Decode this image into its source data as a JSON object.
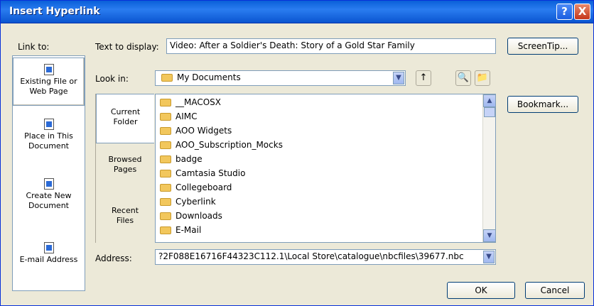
{
  "window": {
    "title": "Insert Hyperlink",
    "help_glyph": "?",
    "close_glyph": "X"
  },
  "labels": {
    "link_to": "Link to:",
    "text_to_display": "Text to display:",
    "look_in": "Look in:",
    "address": "Address:"
  },
  "link_to_items": [
    {
      "line1": "Existing File or",
      "line2": "Web Page",
      "icon": "existing-file-icon",
      "selected": true
    },
    {
      "line1": "Place in This",
      "line2": "Document",
      "icon": "place-in-document-icon",
      "selected": false
    },
    {
      "line1": "Create New",
      "line2": "Document",
      "icon": "create-new-document-icon",
      "selected": false
    },
    {
      "line1": "E-mail Address",
      "line2": "",
      "icon": "email-address-icon",
      "selected": false
    }
  ],
  "text_to_display_value": "Video: After a Soldier's Death: Story of a Gold Star Family",
  "look_in_value": "My Documents",
  "tabs": [
    {
      "line1": "Current",
      "line2": "Folder",
      "selected": true
    },
    {
      "line1": "Browsed",
      "line2": "Pages",
      "selected": false
    },
    {
      "line1": "Recent",
      "line2": "Files",
      "selected": false
    }
  ],
  "files": [
    "__MACOSX",
    "AIMC",
    "AOO Widgets",
    "AOO_Subscription_Mocks",
    "badge",
    "Camtasia Studio",
    "Collegeboard",
    "Cyberlink",
    "Downloads",
    "E-Mail"
  ],
  "address_value": "?2F088E16716F44323C112.1\\Local Store\\catalogue\\nbcfiles\\39677.nbc",
  "buttons": {
    "screentip": "ScreenTip...",
    "bookmark": "Bookmark...",
    "ok": "OK",
    "cancel": "Cancel"
  },
  "icons": {
    "combo_arrow": "▼",
    "scroll_up": "▲",
    "scroll_down": "▼",
    "up_folder": "↑",
    "browse_web": "🔍",
    "browse_file": "📁"
  }
}
